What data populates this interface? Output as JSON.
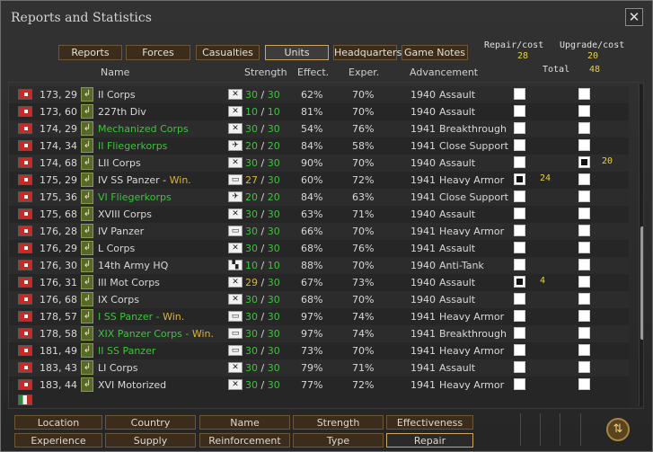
{
  "window": {
    "title": "Reports and Statistics",
    "close_glyph": "✕"
  },
  "tabs": [
    {
      "label": "Reports",
      "active": false
    },
    {
      "label": "Forces",
      "active": false
    },
    {
      "label": "Casualties",
      "active": false
    },
    {
      "label": "Units",
      "active": true
    },
    {
      "label": "Headquarters",
      "active": false
    },
    {
      "label": "Game Notes",
      "active": false
    }
  ],
  "costs": {
    "repair_label": "Repair/cost",
    "upgrade_label": "Upgrade/cost",
    "repair_value": "28",
    "upgrade_value": "20",
    "total_label": "Total",
    "total_value": "48"
  },
  "columns": {
    "name": "Name",
    "strength": "Strength",
    "effect": "Effect.",
    "exper": "Exper.",
    "advancement": "Advancement"
  },
  "units": [
    {
      "loc": "173, 29",
      "name": "II Corps",
      "win": "",
      "color": "white",
      "str_icon": "infantry-icon",
      "cur": "30",
      "max": "30",
      "low": false,
      "eff": "62%",
      "exp": "70%",
      "year": "1940",
      "adv": "Assault",
      "repair": false,
      "upgrade": false,
      "repair_cost": "",
      "upgrade_cost": ""
    },
    {
      "loc": "173, 60",
      "name": "227th Div",
      "win": "",
      "color": "white",
      "str_icon": "infantry-icon",
      "cur": "10",
      "max": "10",
      "low": false,
      "eff": "81%",
      "exp": "70%",
      "year": "1940",
      "adv": "Assault",
      "repair": false,
      "upgrade": false,
      "repair_cost": "",
      "upgrade_cost": ""
    },
    {
      "loc": "174, 29",
      "name": "Mechanized Corps",
      "win": "",
      "color": "green",
      "str_icon": "mechanized-icon",
      "cur": "30",
      "max": "30",
      "low": false,
      "eff": "54%",
      "exp": "76%",
      "year": "1941",
      "adv": "Breakthrough",
      "repair": false,
      "upgrade": false,
      "repair_cost": "",
      "upgrade_cost": ""
    },
    {
      "loc": "174, 34",
      "name": "II Fliegerkorps",
      "win": "",
      "color": "green",
      "str_icon": "air-icon",
      "cur": "20",
      "max": "20",
      "low": false,
      "eff": "84%",
      "exp": "58%",
      "year": "1941",
      "adv": "Close Support",
      "repair": false,
      "upgrade": false,
      "repair_cost": "",
      "upgrade_cost": ""
    },
    {
      "loc": "174, 68",
      "name": "LII Corps",
      "win": "",
      "color": "white",
      "str_icon": "infantry-icon",
      "cur": "30",
      "max": "30",
      "low": false,
      "eff": "90%",
      "exp": "70%",
      "year": "1940",
      "adv": "Assault",
      "repair": false,
      "upgrade": true,
      "repair_cost": "",
      "upgrade_cost": "20"
    },
    {
      "loc": "175, 29",
      "name": "IV SS Panzer",
      "win": "Win.",
      "color": "white",
      "str_icon": "armor-icon",
      "cur": "27",
      "max": "30",
      "low": true,
      "eff": "60%",
      "exp": "72%",
      "year": "1941",
      "adv": "Heavy Armor",
      "repair": true,
      "upgrade": false,
      "repair_cost": "24",
      "upgrade_cost": ""
    },
    {
      "loc": "175, 36",
      "name": "VI Fliegerkorps",
      "win": "",
      "color": "green",
      "str_icon": "air-icon",
      "cur": "20",
      "max": "20",
      "low": false,
      "eff": "84%",
      "exp": "63%",
      "year": "1941",
      "adv": "Close Support",
      "repair": false,
      "upgrade": false,
      "repair_cost": "",
      "upgrade_cost": ""
    },
    {
      "loc": "175, 68",
      "name": "XVIII Corps",
      "win": "",
      "color": "white",
      "str_icon": "infantry-icon",
      "cur": "30",
      "max": "30",
      "low": false,
      "eff": "63%",
      "exp": "71%",
      "year": "1940",
      "adv": "Assault",
      "repair": false,
      "upgrade": false,
      "repair_cost": "",
      "upgrade_cost": ""
    },
    {
      "loc": "176, 28",
      "name": "IV Panzer",
      "win": "",
      "color": "white",
      "str_icon": "armor-icon",
      "cur": "30",
      "max": "30",
      "low": false,
      "eff": "66%",
      "exp": "70%",
      "year": "1941",
      "adv": "Heavy Armor",
      "repair": false,
      "upgrade": false,
      "repair_cost": "",
      "upgrade_cost": ""
    },
    {
      "loc": "176, 29",
      "name": "L Corps",
      "win": "",
      "color": "white",
      "str_icon": "infantry-icon",
      "cur": "30",
      "max": "30",
      "low": false,
      "eff": "68%",
      "exp": "76%",
      "year": "1941",
      "adv": "Assault",
      "repair": false,
      "upgrade": false,
      "repair_cost": "",
      "upgrade_cost": ""
    },
    {
      "loc": "176, 30",
      "name": "14th Army HQ",
      "win": "",
      "color": "white",
      "str_icon": "hq-icon",
      "cur": "10",
      "max": "10",
      "low": false,
      "eff": "88%",
      "exp": "70%",
      "year": "1940",
      "adv": "Anti-Tank",
      "repair": false,
      "upgrade": false,
      "repair_cost": "",
      "upgrade_cost": ""
    },
    {
      "loc": "176, 31",
      "name": "III Mot Corps",
      "win": "",
      "color": "white",
      "str_icon": "infantry-icon",
      "cur": "29",
      "max": "30",
      "low": true,
      "eff": "67%",
      "exp": "73%",
      "year": "1940",
      "adv": "Assault",
      "repair": true,
      "upgrade": false,
      "repair_cost": "4",
      "upgrade_cost": ""
    },
    {
      "loc": "176, 68",
      "name": "IX Corps",
      "win": "",
      "color": "white",
      "str_icon": "infantry-icon",
      "cur": "30",
      "max": "30",
      "low": false,
      "eff": "68%",
      "exp": "70%",
      "year": "1940",
      "adv": "Assault",
      "repair": false,
      "upgrade": false,
      "repair_cost": "",
      "upgrade_cost": ""
    },
    {
      "loc": "178, 57",
      "name": "I SS Panzer",
      "win": "Win.",
      "color": "green",
      "str_icon": "armor-icon",
      "cur": "30",
      "max": "30",
      "low": false,
      "eff": "97%",
      "exp": "74%",
      "year": "1941",
      "adv": "Heavy Armor",
      "repair": false,
      "upgrade": false,
      "repair_cost": "",
      "upgrade_cost": ""
    },
    {
      "loc": "178, 58",
      "name": "XIX Panzer Corps",
      "win": "Win.",
      "color": "green",
      "str_icon": "armor-icon",
      "cur": "30",
      "max": "30",
      "low": false,
      "eff": "97%",
      "exp": "74%",
      "year": "1941",
      "adv": "Breakthrough",
      "repair": false,
      "upgrade": false,
      "repair_cost": "",
      "upgrade_cost": ""
    },
    {
      "loc": "181, 49",
      "name": "II SS Panzer",
      "win": "",
      "color": "green",
      "str_icon": "armor-icon",
      "cur": "30",
      "max": "30",
      "low": false,
      "eff": "73%",
      "exp": "70%",
      "year": "1941",
      "adv": "Heavy Armor",
      "repair": false,
      "upgrade": false,
      "repair_cost": "",
      "upgrade_cost": ""
    },
    {
      "loc": "183, 43",
      "name": "LI Corps",
      "win": "",
      "color": "white",
      "str_icon": "infantry-icon",
      "cur": "30",
      "max": "30",
      "low": false,
      "eff": "79%",
      "exp": "71%",
      "year": "1941",
      "adv": "Assault",
      "repair": false,
      "upgrade": false,
      "repair_cost": "",
      "upgrade_cost": ""
    },
    {
      "loc": "183, 44",
      "name": "XVI Motorized",
      "win": "",
      "color": "white",
      "str_icon": "mechanized-icon",
      "cur": "30",
      "max": "30",
      "low": false,
      "eff": "77%",
      "exp": "72%",
      "year": "1941",
      "adv": "Heavy Armor",
      "repair": false,
      "upgrade": false,
      "repair_cost": "",
      "upgrade_cost": ""
    }
  ],
  "sort_buttons": [
    {
      "label": "Location",
      "active": false
    },
    {
      "label": "Country",
      "active": false
    },
    {
      "label": "Name",
      "active": false
    },
    {
      "label": "Strength",
      "active": false
    },
    {
      "label": "Effectiveness",
      "active": false
    },
    {
      "label": "Experience",
      "active": false
    },
    {
      "label": "Supply",
      "active": false
    },
    {
      "label": "Reinforcement",
      "active": false
    },
    {
      "label": "Type",
      "active": false
    },
    {
      "label": "Repair",
      "active": true
    }
  ],
  "side_button_glyph": "⇅"
}
